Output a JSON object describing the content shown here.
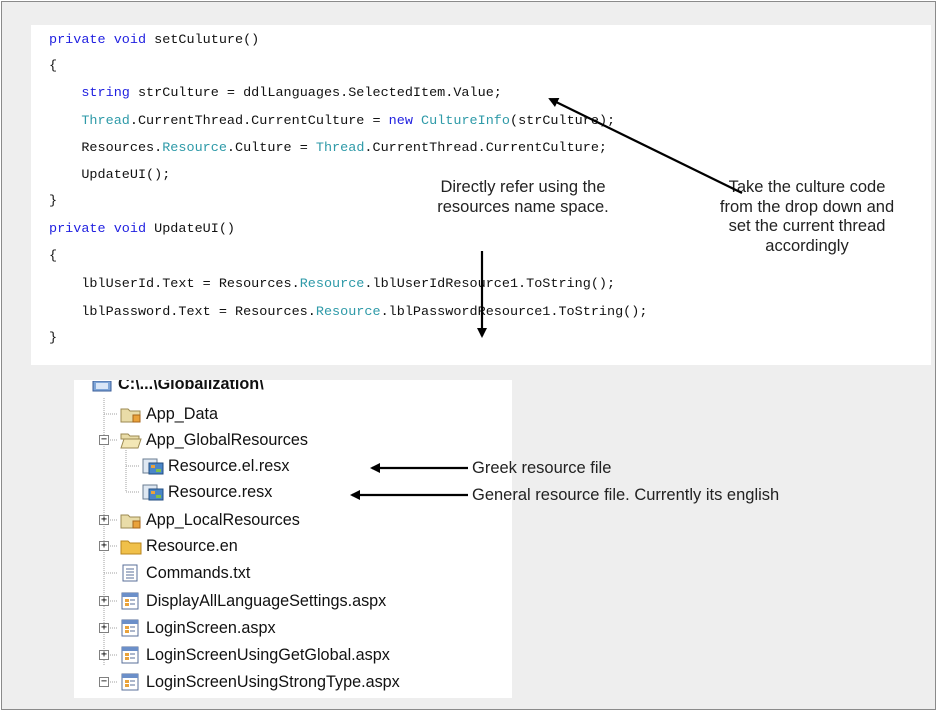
{
  "code": {
    "lines": [
      [
        {
          "t": "private void",
          "c": "kw"
        },
        {
          "t": " setCuluture()",
          "c": ""
        }
      ],
      [
        {
          "t": "{",
          "c": ""
        }
      ],
      [
        {
          "t": "    ",
          "c": ""
        },
        {
          "t": "string",
          "c": "kw"
        },
        {
          "t": " strCulture = ddlLanguages.SelectedItem.Value;",
          "c": ""
        }
      ],
      [
        {
          "t": "    ",
          "c": ""
        },
        {
          "t": "Thread",
          "c": "ty"
        },
        {
          "t": ".CurrentThread.CurrentCulture = ",
          "c": ""
        },
        {
          "t": "new",
          "c": "kw"
        },
        {
          "t": " ",
          "c": ""
        },
        {
          "t": "CultureInfo",
          "c": "ty"
        },
        {
          "t": "(strCulture);",
          "c": ""
        }
      ],
      [
        {
          "t": "    Resources.",
          "c": ""
        },
        {
          "t": "Resource",
          "c": "ty"
        },
        {
          "t": ".Culture = ",
          "c": ""
        },
        {
          "t": "Thread",
          "c": "ty"
        },
        {
          "t": ".CurrentThread.CurrentCulture;",
          "c": ""
        }
      ],
      [
        {
          "t": "    UpdateUI();",
          "c": ""
        }
      ],
      [
        {
          "t": "}",
          "c": ""
        }
      ],
      [
        {
          "t": "private void",
          "c": "kw"
        },
        {
          "t": " UpdateUI()",
          "c": ""
        }
      ],
      [
        {
          "t": "{",
          "c": ""
        }
      ],
      [
        {
          "t": "    lblUserId.Text = Resources.",
          "c": ""
        },
        {
          "t": "Resource",
          "c": "ty"
        },
        {
          "t": ".lblUserIdResource1.ToString();",
          "c": ""
        }
      ],
      [
        {
          "t": "    lblPassword.Text = Resources.",
          "c": ""
        },
        {
          "t": "Resource",
          "c": "ty"
        },
        {
          "t": ".lblPasswordResource1.ToString();",
          "c": ""
        }
      ],
      [
        {
          "t": "}",
          "c": ""
        }
      ]
    ]
  },
  "annotations": {
    "directly_refer_1": "Directly refer using the",
    "directly_refer_2": "resources name space.",
    "take_culture_1": "Take the culture code",
    "take_culture_2": "from the drop down and",
    "take_culture_3": "set the current thread",
    "take_culture_4": "accordingly",
    "greek_resource": "Greek resource file",
    "general_resource": "General resource file. Currently its english"
  },
  "tree": {
    "root": "C:\\...\\Globalization\\",
    "items": [
      {
        "label": "App_Data",
        "icon": "special-folder-icon",
        "expander": "none"
      },
      {
        "label": "App_GlobalResources",
        "icon": "open-folder-icon",
        "expander": "minus"
      },
      {
        "label": "Resource.el.resx",
        "icon": "resource-file-icon",
        "expander": "none"
      },
      {
        "label": "Resource.resx",
        "icon": "resource-file-icon",
        "expander": "none"
      },
      {
        "label": "App_LocalResources",
        "icon": "special-folder-icon",
        "expander": "plus"
      },
      {
        "label": "Resource.en",
        "icon": "folder-icon",
        "expander": "plus"
      },
      {
        "label": "Commands.txt",
        "icon": "text-file-icon",
        "expander": "none"
      },
      {
        "label": "DisplayAllLanguageSettings.aspx",
        "icon": "aspx-file-icon",
        "expander": "plus"
      },
      {
        "label": "LoginScreen.aspx",
        "icon": "aspx-file-icon",
        "expander": "plus"
      },
      {
        "label": "LoginScreenUsingGetGlobal.aspx",
        "icon": "aspx-file-icon",
        "expander": "plus"
      },
      {
        "label": "LoginScreenUsingStrongType.aspx",
        "icon": "aspx-file-icon",
        "expander": "minus"
      }
    ]
  },
  "colors": {
    "keyword": "#1f1fe0",
    "type": "#2e9aa8",
    "folder": "#e8c15a",
    "frame": "#eeeeee"
  }
}
